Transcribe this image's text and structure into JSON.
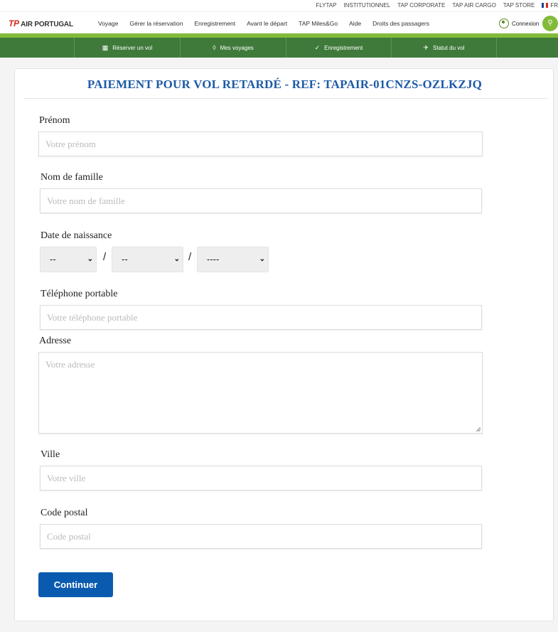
{
  "top_links": [
    "FLYTAP",
    "INSTITUTIONNEL",
    "TAP CORPORATE",
    "TAP AIR CARGO",
    "TAP STORE"
  ],
  "language": "FR",
  "brand": {
    "mark": "TP",
    "name": "AIR PORTUGAL"
  },
  "main_nav": [
    "Voyage",
    "Gérer la réservation",
    "Enregistrement",
    "Avant le départ",
    "TAP Miles&Go",
    "Aide",
    "Droits des passagers"
  ],
  "login_label": "Connexion",
  "sub_nav": [
    {
      "label": "Réserver un vol",
      "icon": "calendar-icon"
    },
    {
      "label": "Mes voyages",
      "icon": "ticket-icon"
    },
    {
      "label": "Enregistrement",
      "icon": "check-circle-icon"
    },
    {
      "label": "Statut du vol",
      "icon": "flight-status-icon"
    }
  ],
  "form": {
    "title": "PAIEMENT POUR VOL RETARDÉ - REF: TAPAIR-01CNZS-OZLKZJQ",
    "first_name": {
      "label": "Prénom",
      "placeholder": "Votre prénom"
    },
    "last_name": {
      "label": "Nom de famille",
      "placeholder": "Votre nom de famille"
    },
    "birth_date": {
      "label": "Date de naissance",
      "day": "--",
      "month": "--",
      "year": "----",
      "separator": "/"
    },
    "phone": {
      "label": "Téléphone portable",
      "placeholder": "Votre téléphone portable"
    },
    "address": {
      "label": "Adresse",
      "placeholder": "Votre adresse"
    },
    "city": {
      "label": "Ville",
      "placeholder": "Votre ville"
    },
    "postal_code": {
      "label": "Code postal",
      "placeholder": "Code postal"
    },
    "submit_label": "Continuer"
  },
  "colors": {
    "title": "#1d5aa6",
    "nav_green": "#3f7a3a",
    "accent_green": "#82bb3a",
    "button": "#0a5bb0"
  }
}
